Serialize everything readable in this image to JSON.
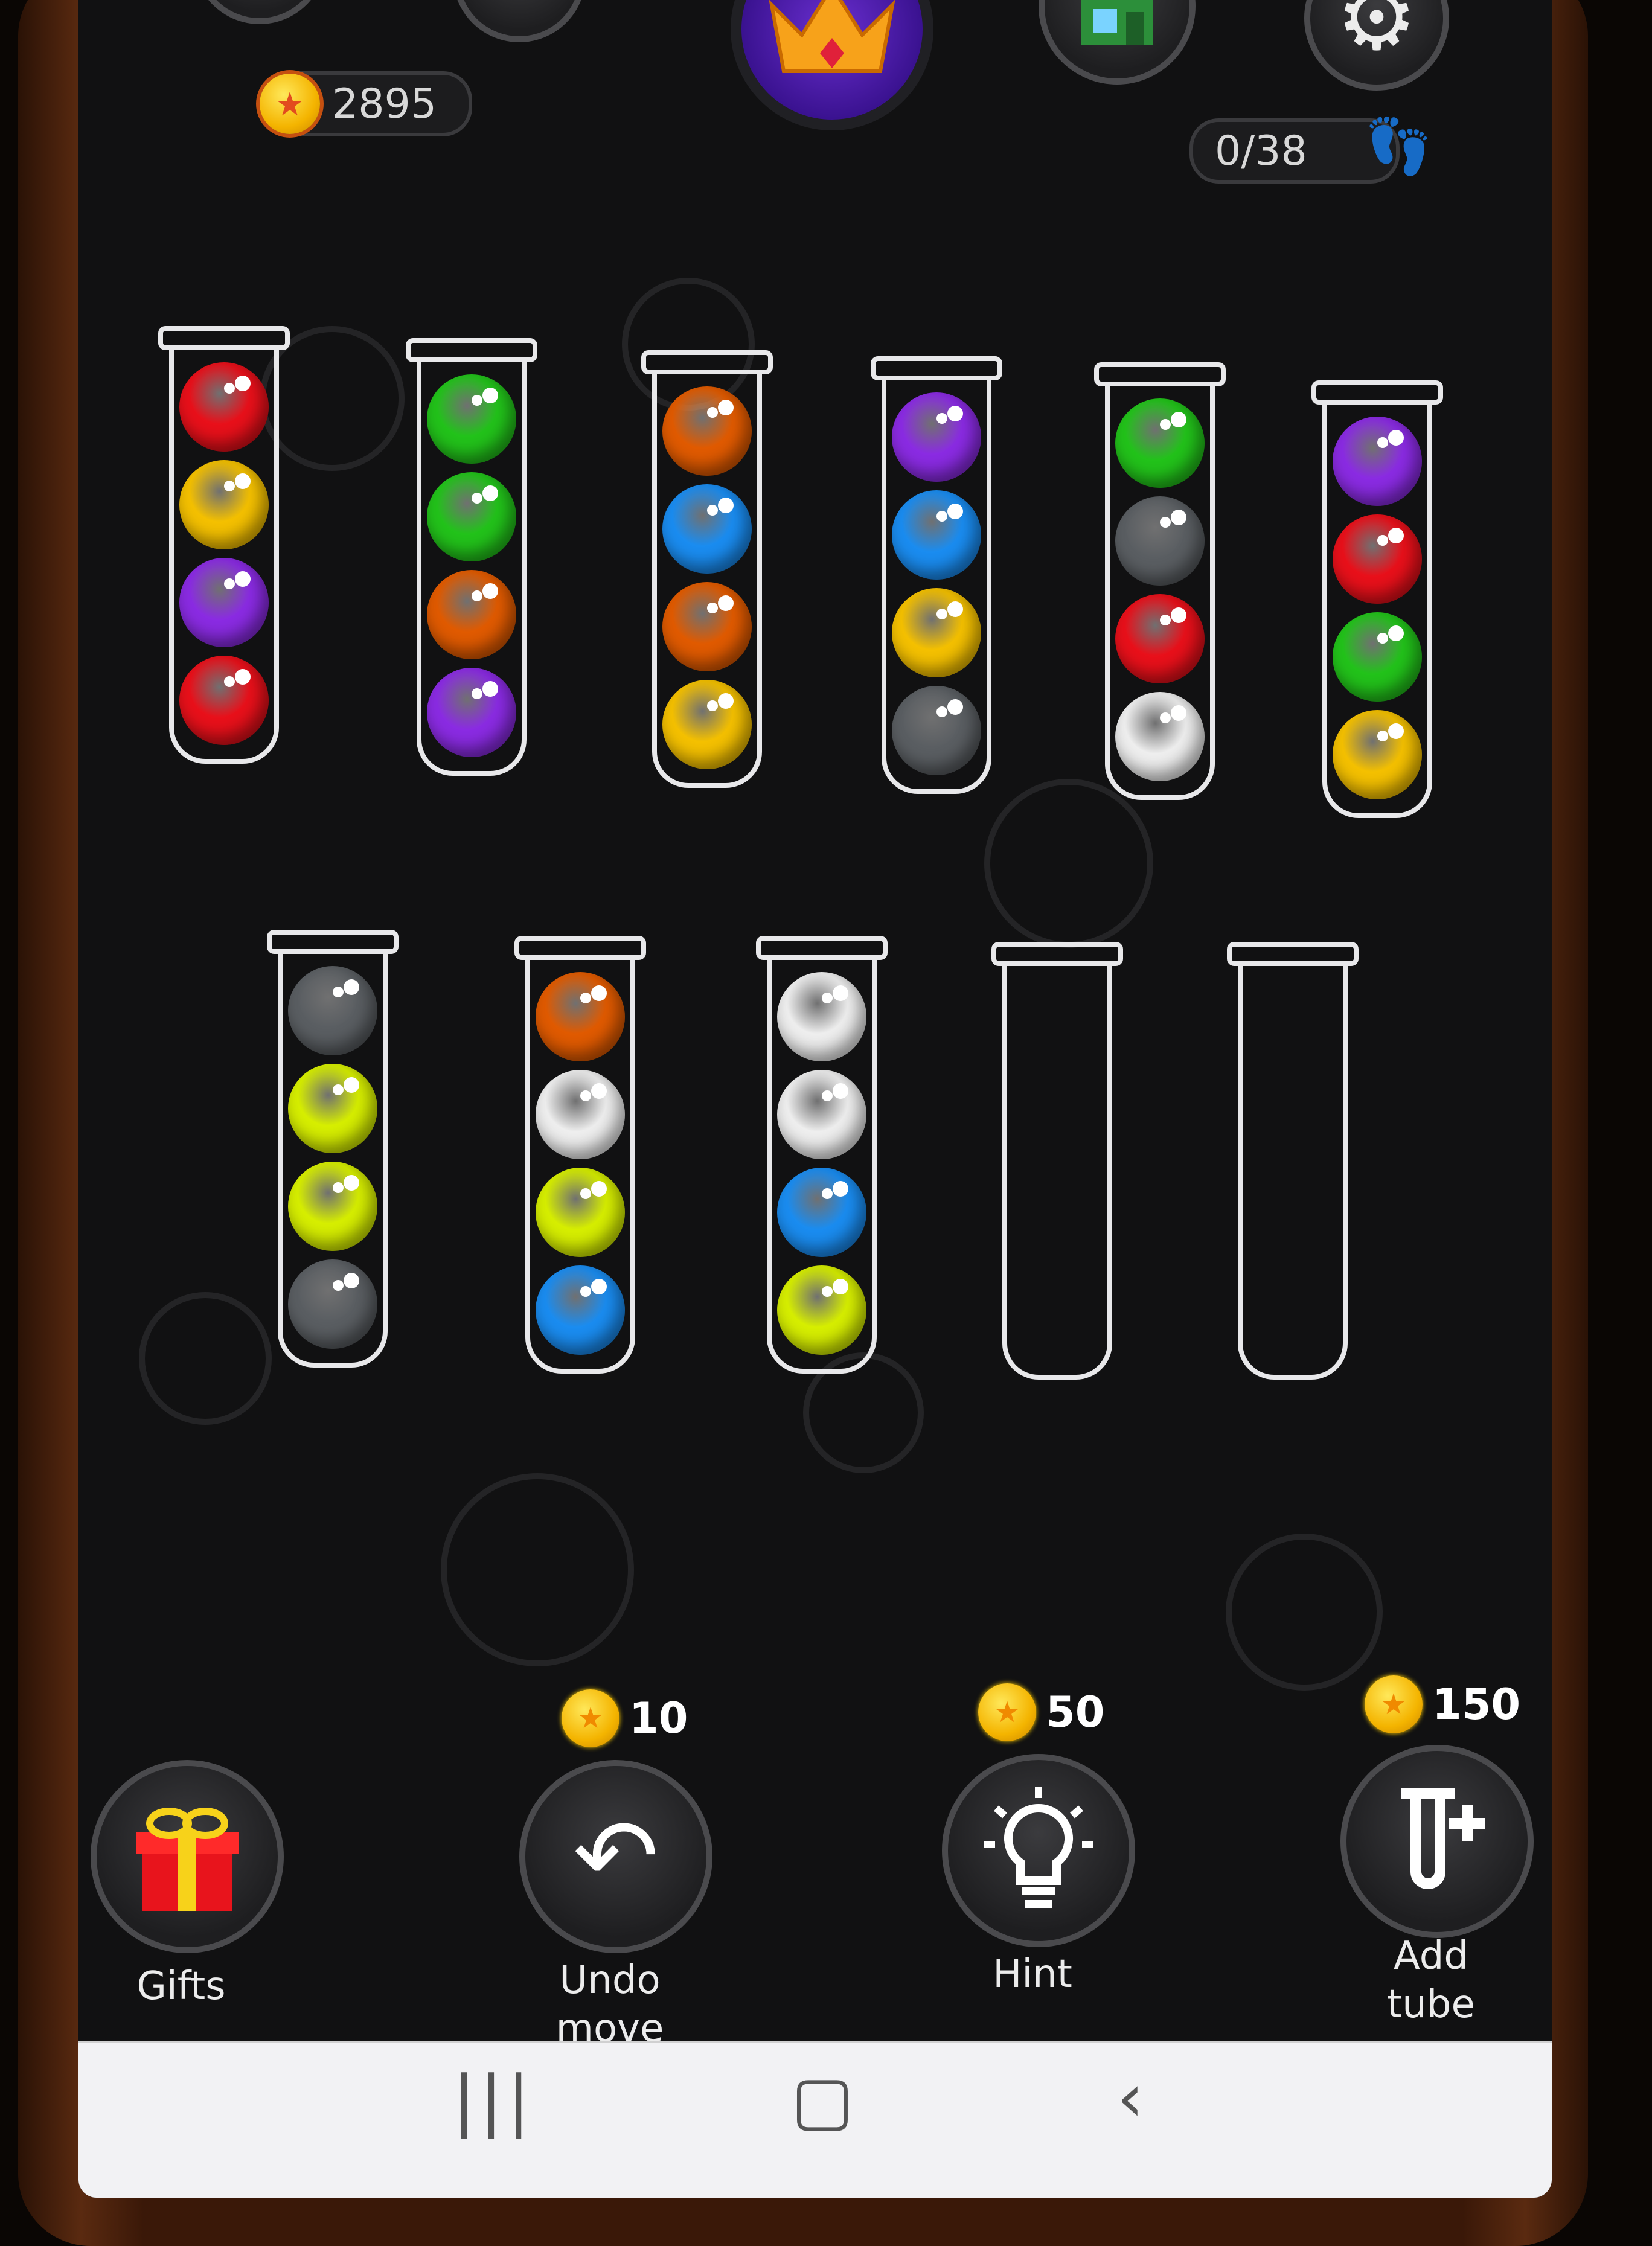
{
  "header": {
    "coins": "2895",
    "moves": "0/38"
  },
  "tubes": [
    [
      "red",
      "yellow",
      "purple",
      "red"
    ],
    [
      "green",
      "green",
      "orange",
      "purple"
    ],
    [
      "orange",
      "blue",
      "orange",
      "yellow"
    ],
    [
      "purple",
      "blue",
      "yellow",
      "gray"
    ],
    [
      "green",
      "gray",
      "red",
      "white"
    ],
    [
      "purple",
      "red",
      "green",
      "yellow"
    ],
    [
      "gray",
      "lime",
      "lime",
      "gray"
    ],
    [
      "orange",
      "white",
      "lime",
      "blue"
    ],
    [
      "white",
      "white",
      "blue",
      "lime"
    ],
    [],
    []
  ],
  "colors": {
    "red": "#e8101a",
    "yellow": "#f4c000",
    "purple": "#8a2be2",
    "green": "#22c21a",
    "orange": "#e05a00",
    "blue": "#1a8cf0",
    "gray": "#5a5e62",
    "white": "#eeeeee",
    "lime": "#d6ee00"
  },
  "actions": {
    "gifts": {
      "label": "Gifts"
    },
    "undo": {
      "label": "Undo\nmove",
      "cost": "10"
    },
    "hint": {
      "label": "Hint",
      "cost": "50"
    },
    "add_tube": {
      "label": "Add\ntube",
      "cost": "150"
    }
  },
  "icons": {
    "top": [
      "replay-icon",
      "crown-icon",
      "shop-icon",
      "gear-icon"
    ],
    "moves": "footsteps-icon",
    "actions": [
      "gift-icon",
      "undo-icon",
      "lightbulb-icon",
      "add-tube-icon"
    ],
    "nav": [
      "recent-apps-icon",
      "home-icon",
      "back-icon"
    ]
  }
}
